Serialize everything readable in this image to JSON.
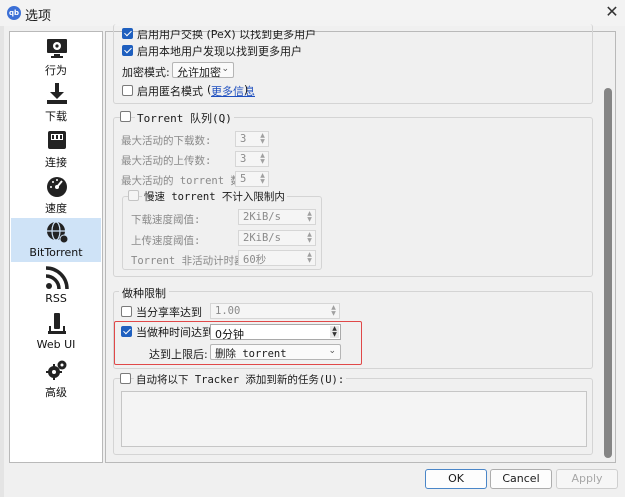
{
  "window": {
    "title": "选项",
    "app_icon": "qb"
  },
  "sidebar": {
    "items": [
      {
        "label": "行为",
        "icon": "monitor-gear-icon"
      },
      {
        "label": "下载",
        "icon": "download-icon"
      },
      {
        "label": "连接",
        "icon": "network-icon"
      },
      {
        "label": "速度",
        "icon": "speedometer-icon"
      },
      {
        "label": "BitTorrent",
        "icon": "bittorrent-globe-icon"
      },
      {
        "label": "RSS",
        "icon": "rss-icon"
      },
      {
        "label": "Web UI",
        "icon": "web-ui-icon"
      },
      {
        "label": "高级",
        "icon": "gears-icon"
      }
    ],
    "active": "BitTorrent"
  },
  "privacy": {
    "pex_label": "启用用户交换 (PeX) 以找到更多用户",
    "lsd_label": "启用本地用户发现以找到更多用户",
    "encryption_label": "加密模式:",
    "encryption_value": "允许加密",
    "anon_label": "启用匿名模式",
    "more_info_open": "(",
    "more_info": "更多信息",
    "more_info_close": ")"
  },
  "queue": {
    "title": "Torrent 队列(Q)",
    "max_downloads_label": "最大活动的下载数:",
    "max_downloads": "3",
    "max_uploads_label": "最大活动的上传数:",
    "max_uploads": "3",
    "max_torrents_label": "最大活动的 torrent 数:",
    "max_torrents": "5",
    "slow_title": "慢速 torrent 不计入限制内",
    "dl_threshold_label": "下载速度阈值:",
    "dl_threshold": "2KiB/s",
    "ul_threshold_label": "上传速度阈值:",
    "ul_threshold": "2KiB/s",
    "inactive_label": "Torrent 非活动计时器:",
    "inactive": "60秒"
  },
  "seeding": {
    "title": "做种限制",
    "ratio_label": "当分享率达到",
    "ratio": "1.00",
    "time_label": "当做种时间达到",
    "time": "0分钟",
    "action_label": "达到上限后:",
    "action": "删除 torrent"
  },
  "tracker": {
    "label": "自动将以下 Tracker 添加到新的任务(U):",
    "value": ""
  },
  "buttons": {
    "ok": "OK",
    "cancel": "Cancel",
    "apply": "Apply"
  },
  "colors": {
    "accent": "#1e5fbf",
    "highlight": "#e04848",
    "active_bg": "#cfe3f7"
  }
}
